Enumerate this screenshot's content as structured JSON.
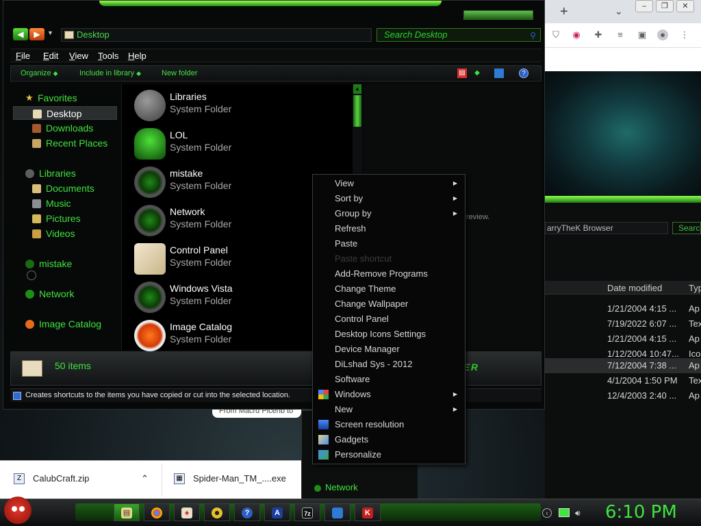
{
  "explorer": {
    "address": "Desktop",
    "search_placeholder": "Search Desktop",
    "menubar": [
      {
        "key": "F",
        "rest": "ile"
      },
      {
        "key": "E",
        "rest": "dit"
      },
      {
        "key": "V",
        "rest": "iew"
      },
      {
        "key": "T",
        "rest": "ools"
      },
      {
        "key": "H",
        "rest": "elp"
      }
    ],
    "commands": [
      "Organize",
      "Include in library",
      "New folder"
    ],
    "nav": {
      "favorites": "Favorites",
      "desktop": "Desktop",
      "downloads": "Downloads",
      "recent": "Recent Places",
      "libraries": "Libraries",
      "documents": "Documents",
      "music": "Music",
      "pictures": "Pictures",
      "videos": "Videos",
      "mistake": "mistake",
      "network": "Network",
      "image_catalog": "Image Catalog"
    },
    "files": [
      {
        "name": "Libraries",
        "type": "System Folder"
      },
      {
        "name": "LOL",
        "type": "System Folder"
      },
      {
        "name": "mistake",
        "type": "System Folder"
      },
      {
        "name": "Network",
        "type": "System Folder"
      },
      {
        "name": "Control Panel",
        "type": "System Folder"
      },
      {
        "name": "Windows Vista",
        "type": "System Folder"
      },
      {
        "name": "Image Catalog",
        "type": "System Folder"
      }
    ],
    "preview_text": "review.",
    "details_count": "50 items",
    "brand": "ZER",
    "status": "Creates shortcuts to the items you have copied or cut into the selected location."
  },
  "context_menu": [
    {
      "label": "View",
      "submenu": true
    },
    {
      "label": "Sort by",
      "submenu": true
    },
    {
      "label": "Group by",
      "submenu": true
    },
    {
      "label": "Refresh"
    },
    {
      "label": "Paste"
    },
    {
      "label": "Paste shortcut",
      "disabled": true
    },
    {
      "label": "Add-Remove Programs"
    },
    {
      "label": "Change Theme"
    },
    {
      "label": "Change Wallpaper"
    },
    {
      "label": "Control Panel"
    },
    {
      "label": "Desktop Icons Settings"
    },
    {
      "label": "Device Manager"
    },
    {
      "label": "DiLshad Sys - 2012"
    },
    {
      "label": "Software"
    },
    {
      "label": "Windows",
      "submenu": true,
      "icon": "windows-flag-icon"
    },
    {
      "label": "New",
      "submenu": true
    },
    {
      "label": "Screen resolution",
      "icon": "monitor-icon"
    },
    {
      "label": "Gadgets",
      "icon": "gadgets-icon"
    },
    {
      "label": "Personalize",
      "icon": "personalize-icon"
    }
  ],
  "bg_explorer": {
    "address": "arryTheK Browser",
    "search": "Searc",
    "col_date": "Date modified",
    "col_type": "Typ",
    "rows": [
      {
        "date": "1/21/2004 4:15 ...",
        "type": "Ap"
      },
      {
        "date": "7/19/2022 6:07 ...",
        "type": "Tex"
      },
      {
        "date": "1/21/2004 4:15 ...",
        "type": "Ap"
      },
      {
        "date": "1/12/2004 10:47...",
        "type": "Ico"
      },
      {
        "date": "7/12/2004 7:38 ...",
        "type": "Ap"
      },
      {
        "date": "4/1/2004 1:50 PM",
        "type": "Tex"
      },
      {
        "date": "12/4/2003 2:40 ...",
        "type": "Ap"
      }
    ]
  },
  "downloads": [
    {
      "name": "CalubCraft.zip"
    },
    {
      "name": "Spider-Man_TM_....exe"
    }
  ],
  "tooltip_fragment": "From Macrd Plcenb to",
  "below_network": "Network",
  "taskbar": {
    "clock": "6:10 PM"
  }
}
